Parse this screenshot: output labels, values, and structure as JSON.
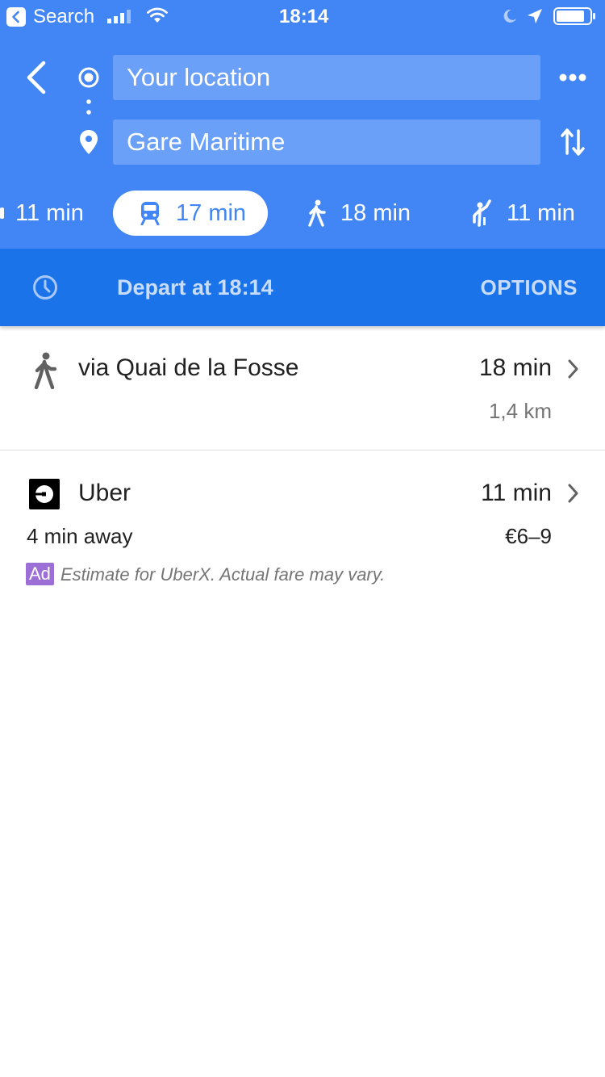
{
  "status_bar": {
    "back_app_label": "Search",
    "time": "18:14"
  },
  "search": {
    "origin_value": "Your location",
    "destination_value": "Gare Maritime"
  },
  "travel_modes": [
    {
      "name": "drive",
      "label": "11 min",
      "selected": false
    },
    {
      "name": "transit",
      "label": "17 min",
      "selected": true
    },
    {
      "name": "walk",
      "label": "18 min",
      "selected": false
    },
    {
      "name": "ride-service",
      "label": "11 min",
      "selected": false
    }
  ],
  "depart": {
    "label": "Depart at 18:14",
    "options_label": "OPTIONS"
  },
  "routes": [
    {
      "type": "walk",
      "title": "via Quai de la Fosse",
      "duration": "18 min",
      "distance": "1,4 km"
    },
    {
      "type": "uber",
      "title": "Uber",
      "duration": "11 min",
      "eta": "4 min away",
      "price": "€6–9",
      "ad_badge": "Ad",
      "ad_note": "Estimate for UberX. Actual fare may vary."
    }
  ],
  "colors": {
    "header_blue": "#4285f4",
    "depart_bar_blue": "#1a73e8",
    "input_blue": "#6aa0f7",
    "ad_purple": "#9c6fd6"
  }
}
